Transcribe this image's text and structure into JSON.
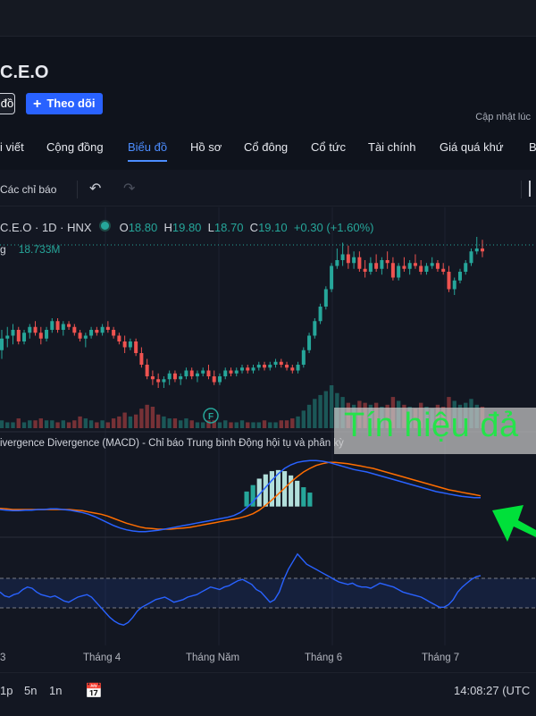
{
  "header": {
    "symbol_title": "C.E.O",
    "left_button_fragment": "đồ",
    "follow_button": "Theo dõi",
    "updated_label": "Cập nhật lúc"
  },
  "tabs": [
    {
      "label": "i viết",
      "active": false
    },
    {
      "label": "Cộng đồng",
      "active": false
    },
    {
      "label": "Biểu đồ",
      "active": true
    },
    {
      "label": "Hồ sơ",
      "active": false
    },
    {
      "label": "Cổ đông",
      "active": false
    },
    {
      "label": "Cổ tức",
      "active": false
    },
    {
      "label": "Tài chính",
      "active": false
    },
    {
      "label": "Giá quá khứ",
      "active": false
    },
    {
      "label": "B",
      "active": false
    }
  ],
  "toolbar": {
    "indicators": "Các chỉ báo",
    "undo_icon": "undo-icon",
    "redo_icon": "redo-icon"
  },
  "legend": {
    "symbol": "C.E.O · 1D · HNX",
    "open_label": "O",
    "open": "18.80",
    "high_label": "H",
    "high": "19.80",
    "low_label": "L",
    "low": "18.70",
    "close_label": "C",
    "close": "19.10",
    "change": "+0.30 (+1.60%)",
    "volume_label": "g",
    "volume_value": "18.733M"
  },
  "macd_title": "ivergence Divergence (MACD) - Chỉ báo Trung bình Động hội tụ và phân kỳ",
  "overlay_text": "Tín hiệu đả",
  "colors": {
    "up": "#26a69a",
    "down": "#ef5350",
    "macd_line": "#2962ff",
    "signal_line": "#ff6d00",
    "arrow": "#00e03a",
    "accent": "#2962ff"
  },
  "chart_data": {
    "type": "candlestick",
    "x_labels": [
      "3",
      "Tháng 4",
      "Tháng Năm",
      "Tháng 6",
      "Tháng 7"
    ],
    "y_range": [
      14.5,
      20.5
    ],
    "price": [
      [
        16.2,
        16.9,
        15.9,
        16.6
      ],
      [
        16.6,
        17.0,
        16.3,
        16.7
      ],
      [
        16.7,
        17.1,
        16.4,
        16.9
      ],
      [
        16.9,
        17.0,
        16.4,
        16.5
      ],
      [
        16.5,
        16.9,
        16.4,
        16.8
      ],
      [
        16.8,
        17.1,
        16.6,
        17.0
      ],
      [
        17.0,
        17.2,
        16.7,
        16.8
      ],
      [
        16.8,
        17.0,
        16.4,
        16.6
      ],
      [
        16.6,
        17.0,
        16.5,
        16.9
      ],
      [
        16.9,
        17.3,
        16.8,
        17.2
      ],
      [
        17.2,
        17.3,
        16.8,
        16.9
      ],
      [
        16.9,
        17.2,
        16.7,
        17.1
      ],
      [
        17.1,
        17.2,
        16.9,
        17.0
      ],
      [
        17.0,
        17.1,
        16.7,
        16.8
      ],
      [
        16.8,
        16.9,
        16.5,
        16.6
      ],
      [
        16.6,
        16.8,
        16.3,
        16.7
      ],
      [
        16.7,
        17.0,
        16.6,
        16.9
      ],
      [
        16.9,
        17.0,
        16.7,
        16.8
      ],
      [
        16.8,
        17.1,
        16.7,
        17.0
      ],
      [
        17.0,
        17.2,
        16.8,
        16.9
      ],
      [
        16.9,
        17.0,
        16.6,
        16.7
      ],
      [
        16.7,
        16.8,
        16.4,
        16.5
      ],
      [
        16.5,
        16.7,
        16.1,
        16.3
      ],
      [
        16.3,
        16.6,
        16.2,
        16.5
      ],
      [
        16.5,
        16.6,
        16.0,
        16.1
      ],
      [
        16.1,
        16.3,
        15.6,
        15.7
      ],
      [
        15.7,
        15.9,
        15.2,
        15.3
      ],
      [
        15.3,
        15.5,
        15.0,
        15.2
      ],
      [
        15.2,
        15.4,
        14.9,
        15.1
      ],
      [
        15.1,
        15.3,
        14.9,
        15.2
      ],
      [
        15.2,
        15.5,
        15.0,
        15.4
      ],
      [
        15.4,
        15.5,
        15.1,
        15.2
      ],
      [
        15.2,
        15.4,
        15.0,
        15.3
      ],
      [
        15.3,
        15.6,
        15.2,
        15.5
      ],
      [
        15.5,
        15.6,
        15.2,
        15.3
      ],
      [
        15.3,
        15.5,
        15.1,
        15.4
      ],
      [
        15.4,
        15.6,
        15.3,
        15.5
      ],
      [
        15.5,
        15.7,
        15.2,
        15.3
      ],
      [
        15.3,
        15.5,
        15.0,
        15.1
      ],
      [
        15.1,
        15.4,
        15.0,
        15.3
      ],
      [
        15.3,
        15.6,
        15.2,
        15.5
      ],
      [
        15.5,
        15.6,
        15.3,
        15.4
      ],
      [
        15.4,
        15.6,
        15.3,
        15.5
      ],
      [
        15.5,
        15.7,
        15.4,
        15.6
      ],
      [
        15.6,
        15.7,
        15.4,
        15.5
      ],
      [
        15.5,
        15.7,
        15.4,
        15.6
      ],
      [
        15.6,
        15.8,
        15.5,
        15.7
      ],
      [
        15.7,
        15.8,
        15.5,
        15.6
      ],
      [
        15.6,
        15.8,
        15.5,
        15.7
      ],
      [
        15.7,
        15.9,
        15.6,
        15.8
      ],
      [
        15.8,
        15.9,
        15.6,
        15.7
      ],
      [
        15.7,
        15.8,
        15.5,
        15.6
      ],
      [
        15.6,
        15.7,
        15.4,
        15.5
      ],
      [
        15.5,
        15.8,
        15.4,
        15.7
      ],
      [
        15.7,
        16.3,
        15.6,
        16.2
      ],
      [
        16.2,
        16.8,
        16.1,
        16.7
      ],
      [
        16.7,
        17.3,
        16.6,
        17.2
      ],
      [
        17.2,
        17.8,
        17.1,
        17.7
      ],
      [
        17.7,
        18.4,
        17.6,
        18.3
      ],
      [
        18.3,
        19.2,
        18.2,
        19.1
      ],
      [
        19.1,
        19.7,
        19.0,
        19.3
      ],
      [
        19.3,
        19.9,
        19.1,
        19.5
      ],
      [
        19.5,
        19.8,
        19.0,
        19.2
      ],
      [
        19.2,
        19.6,
        19.0,
        19.4
      ],
      [
        19.4,
        19.6,
        18.9,
        19.0
      ],
      [
        19.0,
        19.3,
        18.7,
        18.9
      ],
      [
        18.9,
        19.4,
        18.8,
        19.2
      ],
      [
        19.2,
        19.5,
        18.9,
        19.0
      ],
      [
        19.0,
        19.4,
        18.8,
        19.3
      ],
      [
        19.3,
        19.6,
        19.0,
        19.2
      ],
      [
        19.2,
        19.4,
        18.6,
        18.7
      ],
      [
        18.7,
        19.2,
        18.6,
        19.1
      ],
      [
        19.1,
        19.4,
        18.9,
        19.0
      ],
      [
        19.0,
        19.3,
        18.8,
        19.2
      ],
      [
        19.2,
        19.5,
        19.0,
        19.1
      ],
      [
        19.1,
        19.3,
        18.8,
        18.9
      ],
      [
        18.9,
        19.2,
        18.8,
        19.1
      ],
      [
        19.1,
        19.4,
        19.0,
        19.2
      ],
      [
        19.2,
        19.3,
        18.9,
        19.0
      ],
      [
        19.0,
        19.2,
        18.8,
        18.9
      ],
      [
        18.9,
        19.1,
        18.2,
        18.3
      ],
      [
        18.3,
        18.7,
        18.1,
        18.6
      ],
      [
        18.6,
        19.0,
        18.5,
        18.9
      ],
      [
        18.9,
        19.3,
        18.8,
        19.2
      ],
      [
        19.2,
        19.7,
        19.1,
        19.6
      ],
      [
        19.6,
        20.1,
        19.5,
        19.7
      ],
      [
        19.7,
        20.0,
        19.4,
        19.6
      ]
    ],
    "volume": [
      4,
      3,
      3,
      5,
      3,
      4,
      4,
      5,
      4,
      4,
      3,
      4,
      3,
      4,
      6,
      5,
      4,
      3,
      4,
      3,
      5,
      6,
      8,
      6,
      7,
      10,
      12,
      11,
      7,
      6,
      5,
      5,
      4,
      5,
      4,
      3,
      3,
      4,
      4,
      3,
      4,
      3,
      3,
      4,
      3,
      3,
      3,
      4,
      3,
      3,
      4,
      4,
      5,
      6,
      9,
      12,
      15,
      17,
      19,
      22,
      18,
      16,
      13,
      12,
      14,
      13,
      12,
      13,
      11,
      12,
      16,
      14,
      12,
      11,
      10,
      13,
      11,
      10,
      12,
      11,
      16,
      14,
      12,
      13,
      15,
      12,
      11
    ],
    "macd": [
      -0.05,
      -0.06,
      -0.07,
      -0.07,
      -0.06,
      -0.06,
      -0.05,
      -0.05,
      -0.04,
      -0.04,
      -0.05,
      -0.06,
      -0.08,
      -0.1,
      -0.13,
      -0.17,
      -0.22,
      -0.27,
      -0.32,
      -0.36,
      -0.39,
      -0.41,
      -0.42,
      -0.42,
      -0.41,
      -0.4,
      -0.38,
      -0.36,
      -0.34,
      -0.32,
      -0.3,
      -0.28,
      -0.26,
      -0.24,
      -0.22,
      -0.2,
      -0.18,
      -0.15,
      -0.1,
      -0.02,
      0.08,
      0.2,
      0.32,
      0.44,
      0.55,
      0.64,
      0.7,
      0.74,
      0.76,
      0.77,
      0.77,
      0.76,
      0.74,
      0.71,
      0.68,
      0.65,
      0.62,
      0.6,
      0.58,
      0.55,
      0.52,
      0.49,
      0.46,
      0.43,
      0.4,
      0.37,
      0.34,
      0.31,
      0.28,
      0.25,
      0.23,
      0.21,
      0.19,
      0.17,
      0.16,
      0.15,
      0.15
    ],
    "signal": [
      -0.03,
      -0.04,
      -0.05,
      -0.05,
      -0.05,
      -0.05,
      -0.05,
      -0.05,
      -0.05,
      -0.05,
      -0.05,
      -0.05,
      -0.06,
      -0.07,
      -0.09,
      -0.11,
      -0.13,
      -0.16,
      -0.2,
      -0.24,
      -0.28,
      -0.31,
      -0.34,
      -0.36,
      -0.37,
      -0.38,
      -0.38,
      -0.38,
      -0.37,
      -0.36,
      -0.35,
      -0.33,
      -0.31,
      -0.29,
      -0.27,
      -0.25,
      -0.23,
      -0.21,
      -0.19,
      -0.16,
      -0.12,
      -0.06,
      0.02,
      0.11,
      0.21,
      0.31,
      0.41,
      0.5,
      0.58,
      0.64,
      0.69,
      0.72,
      0.74,
      0.74,
      0.73,
      0.72,
      0.7,
      0.68,
      0.66,
      0.64,
      0.61,
      0.58,
      0.55,
      0.52,
      0.49,
      0.46,
      0.43,
      0.4,
      0.37,
      0.34,
      0.31,
      0.28,
      0.26,
      0.24,
      0.22,
      0.2,
      0.18
    ],
    "rsi": [
      48,
      45,
      44,
      46,
      47,
      50,
      52,
      51,
      48,
      46,
      45,
      44,
      45,
      43,
      41,
      40,
      42,
      44,
      45,
      46,
      44,
      40,
      36,
      32,
      28,
      25,
      23,
      22,
      24,
      28,
      33,
      36,
      38,
      40,
      42,
      43,
      44,
      42,
      40,
      41,
      42,
      44,
      45,
      46,
      48,
      50,
      52,
      51,
      50,
      52,
      53,
      55,
      57,
      58,
      56,
      54,
      50,
      48,
      44,
      40,
      42,
      48,
      58,
      66,
      72,
      78,
      74,
      70,
      68,
      66,
      64,
      62,
      60,
      58,
      56,
      55,
      54,
      55,
      53,
      52,
      52,
      51,
      53,
      55,
      54,
      53,
      52,
      50,
      48,
      47,
      46,
      45,
      44,
      42,
      40,
      38,
      36,
      36,
      38,
      42,
      48,
      52,
      55,
      58,
      60,
      61
    ]
  },
  "xaxis": [
    "3",
    "Tháng 4",
    "Tháng Năm",
    "Tháng 6",
    "Tháng 7"
  ],
  "bottom_bar": {
    "ranges": [
      "1p",
      "5n",
      "1n"
    ],
    "calendar_icon": "calendar-range-icon",
    "time": "14:08:27 (UTC"
  }
}
